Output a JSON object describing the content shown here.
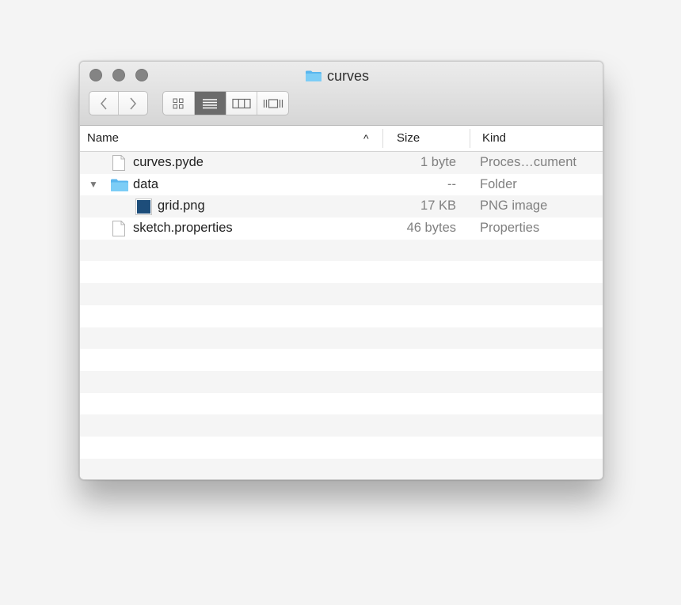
{
  "window": {
    "title": "curves",
    "title_icon": "folder-icon"
  },
  "toolbar": {
    "back_icon": "chevron-left-icon",
    "forward_icon": "chevron-right-icon",
    "views": [
      {
        "name": "icon-view-icon",
        "active": false
      },
      {
        "name": "list-view-icon",
        "active": true
      },
      {
        "name": "column-view-icon",
        "active": false
      },
      {
        "name": "cover-flow-icon",
        "active": false
      }
    ]
  },
  "columns": {
    "name": "Name",
    "size": "Size",
    "kind": "Kind",
    "sort_indicator": "^"
  },
  "files": [
    {
      "name": "curves.pyde",
      "size": "1 byte",
      "kind": "Proces…cument",
      "icon": "document-icon",
      "indent": 0
    },
    {
      "name": "data",
      "size": "--",
      "kind": "Folder",
      "icon": "folder-icon",
      "indent": 0,
      "expanded": true,
      "disclosure": "▼"
    },
    {
      "name": "grid.png",
      "size": "17 KB",
      "kind": "PNG image",
      "icon": "image-icon",
      "indent": 1
    },
    {
      "name": "sketch.properties",
      "size": "46 bytes",
      "kind": "Properties",
      "icon": "document-icon",
      "indent": 0
    }
  ],
  "colors": {
    "folder": "#6cc3f2",
    "image_thumb": "#1d4d7a",
    "active_view": "#6b6b6b"
  }
}
